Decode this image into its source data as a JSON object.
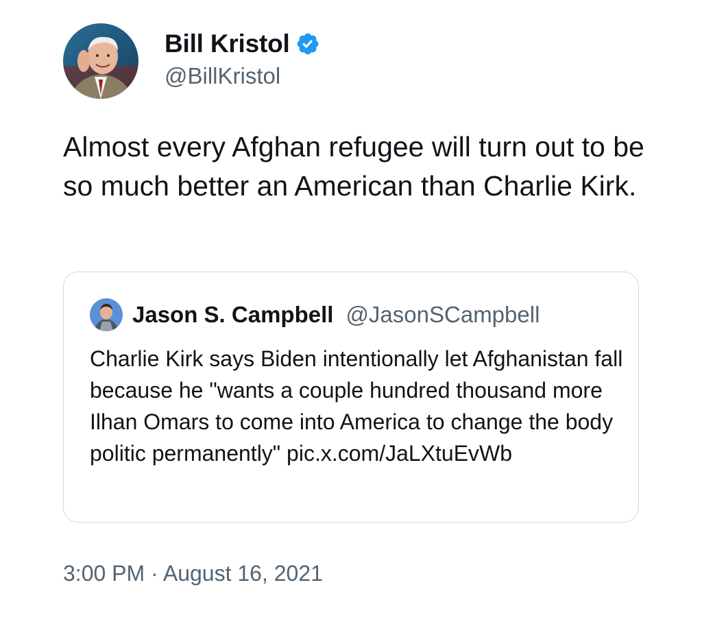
{
  "author": {
    "display_name": "Bill Kristol",
    "handle": "@BillKristol",
    "verified": true,
    "verified_color": "#1d9bf0"
  },
  "tweet": {
    "text": "Almost every Afghan refugee will turn out to be so much better an American than Charlie Kirk."
  },
  "quoted_tweet": {
    "display_name": "Jason S. Campbell",
    "handle": "@JasonSCampbell",
    "text": "Charlie Kirk says Biden intentionally let Afghanistan fall because he \"wants a couple hundred thousand more Ilhan Omars to come into America to change the body politic permanently\" pic.x.com/JaLXtuEvWb"
  },
  "timestamp": "3:00 PM · August 16, 2021",
  "colors": {
    "text_primary": "#0f1419",
    "text_secondary": "#536471",
    "border": "#cfd9de"
  }
}
